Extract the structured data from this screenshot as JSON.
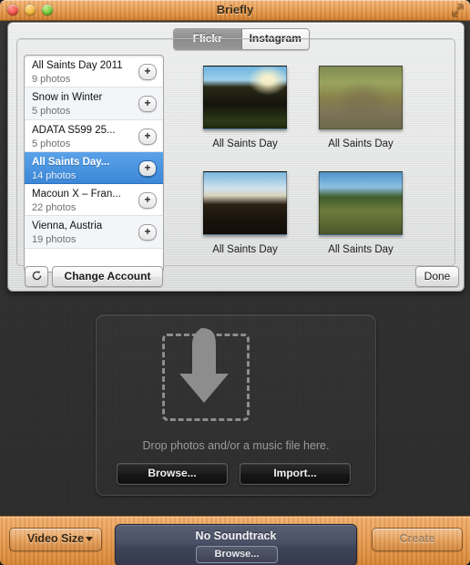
{
  "window": {
    "title": "Briefly",
    "traffic_lights": [
      "close-button",
      "minimize-button",
      "zoom-button"
    ],
    "resize_icon": "resize-diagonal-icon"
  },
  "popover": {
    "tabs": [
      {
        "label": "Flickr",
        "selected": true
      },
      {
        "label": "Instagram",
        "selected": false
      }
    ],
    "albums": [
      {
        "title": "All Saints Day 2011",
        "count": "9 photos",
        "selected": false,
        "add_icon": "plus-icon"
      },
      {
        "title": "Snow in Winter",
        "count": "5 photos",
        "selected": false,
        "add_icon": "plus-icon"
      },
      {
        "title": "ADATA S599 25...",
        "count": "5 photos",
        "selected": false,
        "add_icon": "plus-icon"
      },
      {
        "title": "All Saints Day...",
        "count": "14 photos",
        "selected": true,
        "add_icon": "plus-icon"
      },
      {
        "title": "Macoun X – Fran...",
        "count": "22 photos",
        "selected": false,
        "add_icon": "plus-icon"
      },
      {
        "title": "Vienna, Austria",
        "count": "19 photos",
        "selected": false,
        "add_icon": "plus-icon"
      }
    ],
    "photos": [
      {
        "caption": "All Saints Day"
      },
      {
        "caption": "All Saints Day"
      },
      {
        "caption": "All Saints Day"
      },
      {
        "caption": "All Saints Day"
      }
    ],
    "refresh_icon": "refresh-icon",
    "change_account_label": "Change Account",
    "done_label": "Done",
    "selection_color": "#3c87d8"
  },
  "dropzone": {
    "arrow_icon": "download-arrow-icon",
    "hint": "Drop photos and/or a music file here.",
    "browse_label": "Browse...",
    "import_label": "Import..."
  },
  "toolbar": {
    "video_size_label": "Video Size",
    "video_size_caret": "chevron-down-icon",
    "soundtrack_title": "No Soundtrack",
    "soundtrack_browse_label": "Browse...",
    "create_label": "Create",
    "create_enabled": false
  }
}
